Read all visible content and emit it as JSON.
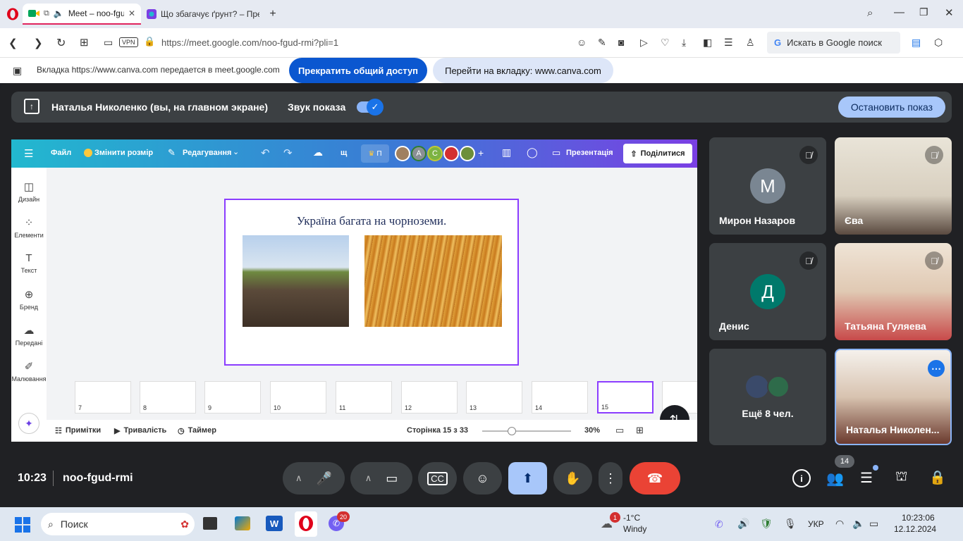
{
  "browser": {
    "tabs": [
      {
        "title": "Meet – noo-fgud-r",
        "active": true
      },
      {
        "title": "Що збагачує ґрунт? – Пре",
        "active": false
      }
    ],
    "url": "https://meet.google.com/noo-fgud-rmi?pli=1",
    "vpn_label": "VPN",
    "search_placeholder": "Искать в Google поиск"
  },
  "share_banner": {
    "message": "Вкладка https://www.canva.com передается в meet.google.com",
    "stop_label": "Прекратить общий доступ",
    "goto_label": "Перейти на вкладку: www.canva.com"
  },
  "presenter_bar": {
    "presenter": "Наталья Николенко (вы, на главном экране)",
    "sound_label": "Звук показа",
    "stop_button": "Остановить показ"
  },
  "canva": {
    "menu_file": "Файл",
    "menu_resize": "Змінити розмір",
    "menu_edit": "Редагування",
    "menu_extra": "щ",
    "menu_p": "П",
    "avatars": [
      "А",
      "С"
    ],
    "present_label": "Презентація",
    "share_label": "Поділитися",
    "sidebar": [
      "Дизайн",
      "Елементи",
      "Текст",
      "Бренд",
      "Передані",
      "Малювання"
    ],
    "slide_title": "Україна багата на чорноземи.",
    "thumbs": [
      "7",
      "8",
      "9",
      "10",
      "11",
      "12",
      "13",
      "14",
      "15"
    ],
    "notes_label": "Примітки",
    "duration_label": "Тривалість",
    "timer_label": "Таймер",
    "page_label": "Сторінка 15 з 33",
    "zoom_label": "30%"
  },
  "participants": [
    {
      "name": "Мирон Назаров",
      "initial": "М",
      "color": "#7a8692"
    },
    {
      "name": "Єва"
    },
    {
      "name": "Денис",
      "initial": "Д",
      "color": "#00796b"
    },
    {
      "name": "Татьяна Гуляева"
    },
    {
      "name": "Ещё 8 чел."
    },
    {
      "name": "Наталья Николен..."
    }
  ],
  "controls": {
    "time": "10:23",
    "meeting_code": "noo-fgud-rmi",
    "people_count": "14"
  },
  "taskbar": {
    "search_label": "Поиск",
    "notification_badge": "20",
    "weather_temp": "-1°C",
    "weather_desc": "Windy",
    "weather_badge": "1",
    "lang": "УКР",
    "clock_time": "10:23:06",
    "clock_date": "12.12.2024"
  }
}
